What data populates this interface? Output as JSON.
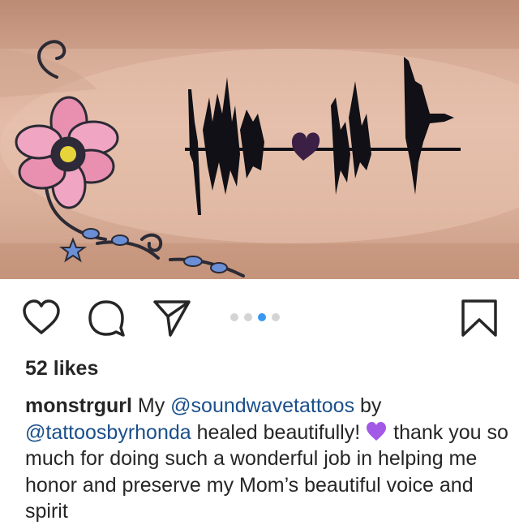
{
  "post": {
    "image": {
      "subject": "sound wave tattoo with heart on forearm next to pink flower tattoo"
    },
    "carousel": {
      "total": 4,
      "active_index": 2
    },
    "likes_text": "52 likes",
    "caption": {
      "username": "monstrgurl",
      "part1": " My ",
      "mention1": "@soundwavetattoos",
      "part2": " by ",
      "mention2": "@tattoosbyrhonda",
      "part3": "  healed beautifully!",
      "emoji": "purple-heart-emoji",
      "part4": " thank you so much for doing such a wonderful job in helping me honor and preserve my Mom’s beautiful voice and spirit"
    }
  },
  "colors": {
    "carousel_active": "#3897f0",
    "carousel_inactive": "#d4d4d4",
    "mention": "#1a4f8a",
    "text": "#262626",
    "heart_emoji": "#a259e6"
  },
  "icons": {
    "like": "heart-outline-icon",
    "comment": "comment-bubble-icon",
    "share": "paper-plane-icon",
    "save": "bookmark-icon"
  }
}
